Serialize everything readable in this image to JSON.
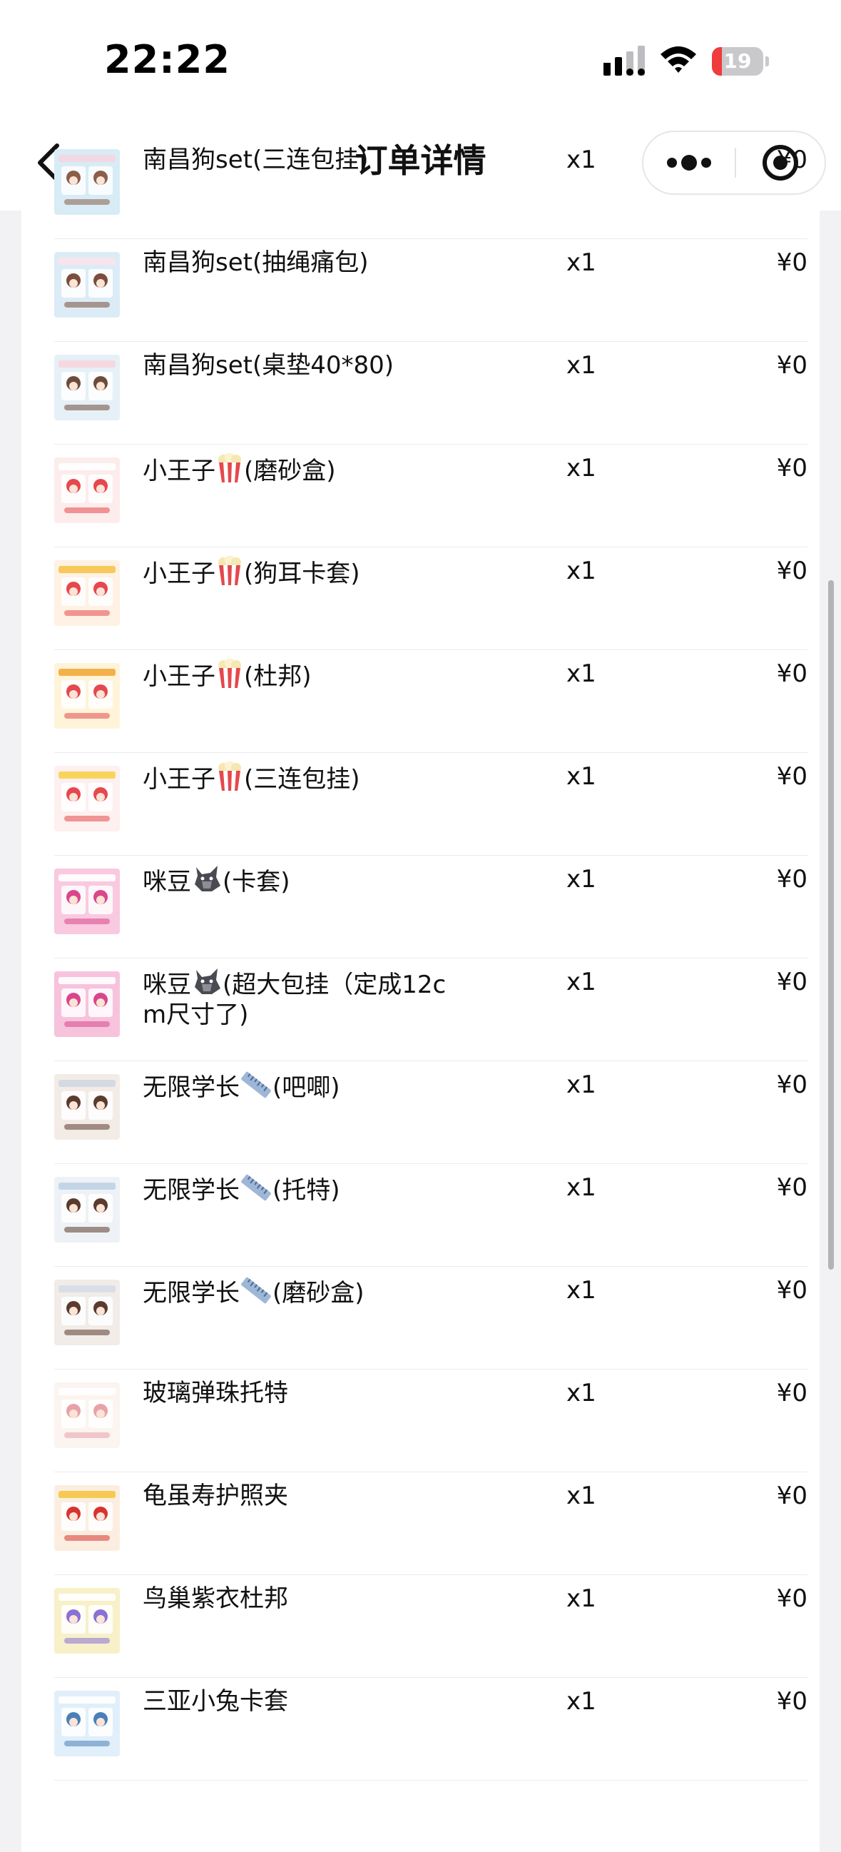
{
  "status_bar": {
    "time": "22:22",
    "battery_level": "19",
    "battery_percent": 19,
    "battery_color": "#ef3b3b"
  },
  "nav": {
    "title": "订单详情",
    "back_icon": "chevron-left-icon",
    "more_icon": "more-dots-icon",
    "close_icon": "target-close-icon"
  },
  "items": [
    {
      "name_prefix": "南昌狗set(三连包挂)",
      "emoji": "",
      "name_suffix": "",
      "qty": "x1",
      "price": "¥0",
      "thumb_colors": [
        "#d7ecf5",
        "#8b5e4a",
        "#f5d6e0"
      ]
    },
    {
      "name_prefix": "南昌狗set(抽绳痛包)",
      "emoji": "",
      "name_suffix": "",
      "qty": "x1",
      "price": "¥0",
      "thumb_colors": [
        "#dcecf6",
        "#7a4e3b",
        "#fbe3ea"
      ]
    },
    {
      "name_prefix": "南昌狗set(桌垫40*80)",
      "emoji": "",
      "name_suffix": "",
      "qty": "x1",
      "price": "¥0",
      "thumb_colors": [
        "#e6f0f7",
        "#6e4a3a",
        "#f7d5de"
      ]
    },
    {
      "name_prefix": "小王子",
      "emoji": "popcorn-icon",
      "name_suffix": "(磨砂盒)",
      "qty": "x1",
      "price": "¥0",
      "thumb_colors": [
        "#fdecec",
        "#e5484d",
        "#ffffff"
      ]
    },
    {
      "name_prefix": "小王子",
      "emoji": "popcorn-icon",
      "name_suffix": "(狗耳卡套)",
      "qty": "x1",
      "price": "¥0",
      "thumb_colors": [
        "#fff1e3",
        "#e5484d",
        "#f6c34a"
      ]
    },
    {
      "name_prefix": "小王子",
      "emoji": "popcorn-icon",
      "name_suffix": "(杜邦)",
      "qty": "x1",
      "price": "¥0",
      "thumb_colors": [
        "#fff4d9",
        "#e5484d",
        "#f2a93b"
      ]
    },
    {
      "name_prefix": "小王子",
      "emoji": "popcorn-icon",
      "name_suffix": "(三连包挂)",
      "qty": "x1",
      "price": "¥0",
      "thumb_colors": [
        "#fdf0ef",
        "#e5484d",
        "#f6d14b"
      ]
    },
    {
      "name_prefix": "咪豆",
      "emoji": "wolf-icon",
      "name_suffix": "(卡套)",
      "qty": "x1",
      "price": "¥0",
      "thumb_colors": [
        "#f9c9df",
        "#d9468b",
        "#ffffff"
      ]
    },
    {
      "name_prefix": "咪豆",
      "emoji": "wolf-icon",
      "name_suffix": "(超大包挂（定成12cm尺寸了)",
      "qty": "x1",
      "price": "¥0",
      "thumb_colors": [
        "#f7c3dc",
        "#d9468b",
        "#ffffff"
      ]
    },
    {
      "name_prefix": "无限学长",
      "emoji": "ruler-icon",
      "name_suffix": "(吧唧)",
      "qty": "x1",
      "price": "¥0",
      "thumb_colors": [
        "#f3ece6",
        "#5b3b2e",
        "#cfd8e3"
      ]
    },
    {
      "name_prefix": "无限学长",
      "emoji": "ruler-icon",
      "name_suffix": "(托特)",
      "qty": "x1",
      "price": "¥0",
      "thumb_colors": [
        "#eef2f6",
        "#5b3b2e",
        "#bcd3e6"
      ]
    },
    {
      "name_prefix": "无限学长",
      "emoji": "ruler-icon",
      "name_suffix": "(磨砂盒)",
      "qty": "x1",
      "price": "¥0",
      "thumb_colors": [
        "#f1ece8",
        "#5b3b2e",
        "#d6dde6"
      ]
    },
    {
      "name_prefix": "玻璃弹珠托特",
      "emoji": "",
      "name_suffix": "",
      "qty": "x1",
      "price": "¥0",
      "thumb_colors": [
        "#fbf4f1",
        "#e8a1a9",
        "#ffffff"
      ]
    },
    {
      "name_prefix": "龟虽寿护照夹",
      "emoji": "",
      "name_suffix": "",
      "qty": "x1",
      "price": "¥0",
      "thumb_colors": [
        "#fbeee0",
        "#d8342f",
        "#f5c542"
      ]
    },
    {
      "name_prefix": "鸟巢紫衣杜邦",
      "emoji": "",
      "name_suffix": "",
      "qty": "x1",
      "price": "¥0",
      "thumb_colors": [
        "#f7f0c9",
        "#8a6fd6",
        "#ffffff"
      ]
    },
    {
      "name_prefix": "三亚小兔卡套",
      "emoji": "",
      "name_suffix": "",
      "qty": "x1",
      "price": "¥0",
      "thumb_colors": [
        "#e1effa",
        "#4a7fb8",
        "#ffffff"
      ]
    }
  ]
}
